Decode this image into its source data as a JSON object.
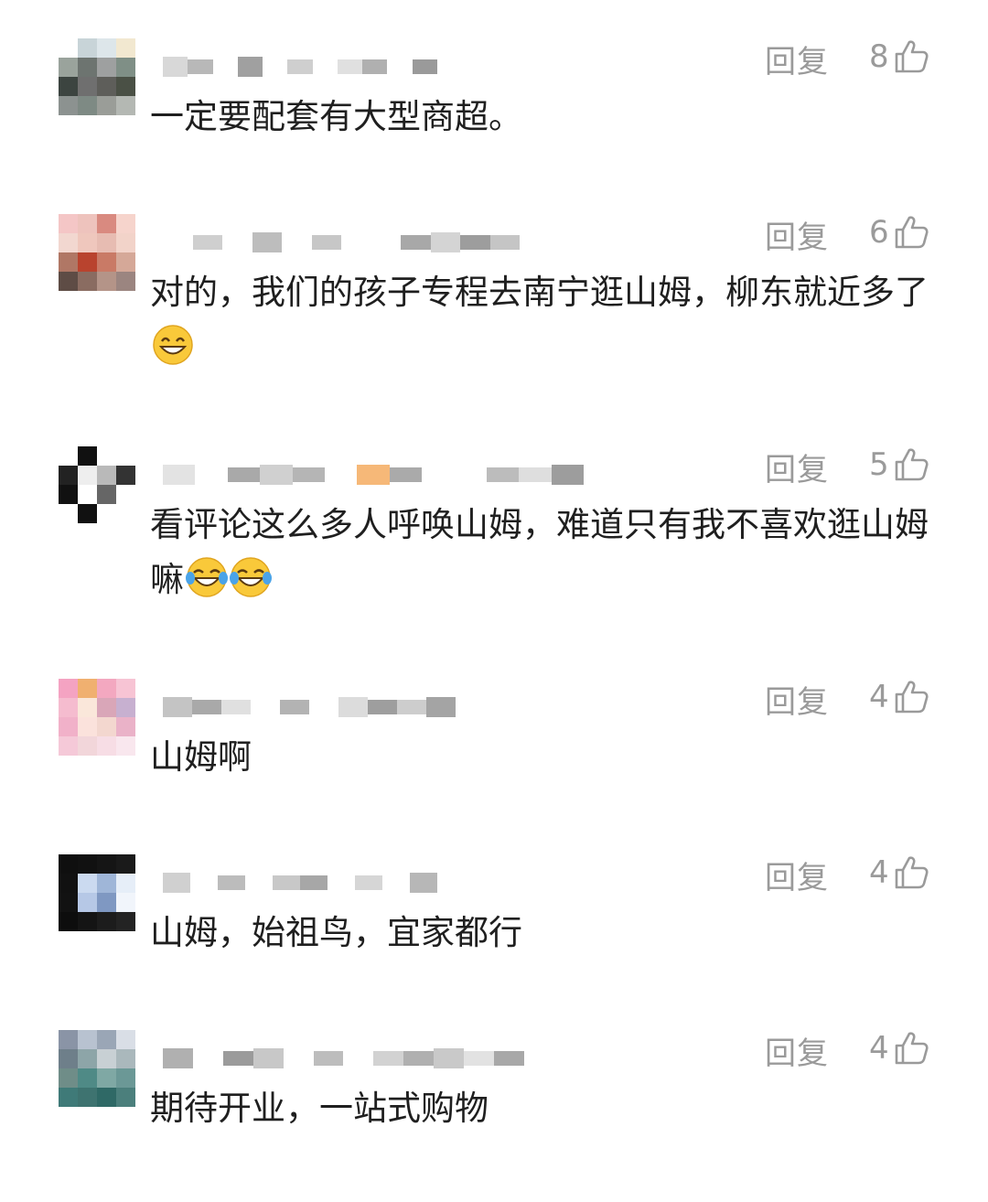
{
  "comments": [
    {
      "reply": "回复",
      "likes": "8",
      "text": "一定要配套有大型商超。",
      "emojis": [],
      "avatar": [
        "#ffffff",
        "#c8d4d8",
        "#dde6ea",
        "#f2e8d0",
        "#9aa39c",
        "#6d7470",
        "#9ea0a0",
        "#7f8f86",
        "#3c4440",
        "#6f6f6f",
        "#5e5e5a",
        "#4a5045",
        "#8c9290",
        "#7e8a84",
        "#9a9d98",
        "#b4b8b3"
      ],
      "username_blocks": [
        "#d8d8d8",
        "#b8b8b8",
        "#ffffff",
        "#a0a0a0",
        "#ffffff",
        "#cfcfcf",
        "#ffffff",
        "#e0e0e0",
        "#b0b0b0",
        "#ffffff",
        "#9a9a9a"
      ]
    },
    {
      "reply": "回复",
      "likes": "6",
      "text": "对的，我们的孩子专程去南宁逛山姆，柳东就近多了",
      "emojis": [
        "grinning-face"
      ],
      "avatar": [
        "#f4c6c6",
        "#eec3bd",
        "#d98a80",
        "#f6d4cc",
        "#f2d7d0",
        "#efc7bd",
        "#e7bcb2",
        "#f2d3c9",
        "#b07765",
        "#b9432e",
        "#c97a66",
        "#d5a898",
        "#5e4c45",
        "#8a6c61",
        "#b49488",
        "#9b8580"
      ],
      "username_blocks": [
        "#ffffff",
        "#cfcfcf",
        "#ffffff",
        "#bdbdbd",
        "#ffffff",
        "#c7c7c7",
        "#ffffff",
        "#ffffff",
        "#a8a8a8",
        "#d4d4d4",
        "#9d9d9d",
        "#c5c5c5"
      ]
    },
    {
      "reply": "回复",
      "likes": "5",
      "text": "看评论这么多人呼唤山姆，难道只有我不喜欢逛山姆嘛",
      "emojis": [
        "tears-of-joy-face",
        "tears-of-joy-face"
      ],
      "avatar": [
        "#ffffff",
        "#111111",
        "#ffffff",
        "#ffffff",
        "#222222",
        "#eeeeee",
        "#b9b9b9",
        "#333333",
        "#111111",
        "#ffffff",
        "#666666",
        "#ffffff",
        "#ffffff",
        "#111111",
        "#ffffff",
        "#ffffff"
      ],
      "username_blocks": [
        "#e3e3e3",
        "#ffffff",
        "#a9a9a9",
        "#d0d0d0",
        "#b5b5b5",
        "#ffffff",
        "#f6b878",
        "#aaaaaa",
        "#ffffff",
        "#ffffff",
        "#bcbcbc",
        "#dedede",
        "#9d9d9d"
      ]
    },
    {
      "reply": "回复",
      "likes": "4",
      "text": "山姆啊",
      "emojis": [],
      "avatar": [
        "#f4a3c2",
        "#f0b070",
        "#f3a8c0",
        "#f7c4d4",
        "#f5bccf",
        "#fae7da",
        "#d9a6b8",
        "#c7b0d0",
        "#f1b1c9",
        "#fbe2dc",
        "#f3d7cf",
        "#eab2c8",
        "#f5c9d8",
        "#f2d6da",
        "#f7dde5",
        "#f9e7ee"
      ],
      "username_blocks": [
        "#c4c4c4",
        "#a9a9a9",
        "#e0e0e0",
        "#ffffff",
        "#b3b3b3",
        "#ffffff",
        "#dcdcdc",
        "#9e9e9e",
        "#cdcdcd",
        "#a4a4a4"
      ]
    },
    {
      "reply": "回复",
      "likes": "4",
      "text": "山姆，始祖鸟，宜家都行",
      "emojis": [],
      "avatar": [
        "#0f0f0f",
        "#111111",
        "#151515",
        "#1a1a1a",
        "#111111",
        "#cbdaf0",
        "#9fb6d8",
        "#e6eef8",
        "#121212",
        "#b6c8e6",
        "#7f98c2",
        "#f1f5fb",
        "#0d0d0d",
        "#141414",
        "#1c1c1c",
        "#232323"
      ],
      "username_blocks": [
        "#d0d0d0",
        "#ffffff",
        "#bcbcbc",
        "#ffffff",
        "#c8c8c8",
        "#a7a7a7",
        "#ffffff",
        "#d6d6d6",
        "#ffffff",
        "#b7b7b7"
      ]
    },
    {
      "reply": "回复",
      "likes": "4",
      "text": "期待开业，一站式购物",
      "emojis": [],
      "avatar": [
        "#8a94a6",
        "#b8c2d0",
        "#9aa6b6",
        "#d9dee6",
        "#6e7f8a",
        "#8da5a8",
        "#c8d0d4",
        "#aab8bc",
        "#6f8d88",
        "#4f8a86",
        "#7fa8a4",
        "#6b9896",
        "#3f7a78",
        "#3e7370",
        "#2f6966",
        "#4b7f7c"
      ],
      "username_blocks": [
        "#b0b0b0",
        "#ffffff",
        "#9b9b9b",
        "#c8c8c8",
        "#ffffff",
        "#bdbdbd",
        "#ffffff",
        "#d2d2d2",
        "#b0b0b0",
        "#c9c9c9",
        "#e2e2e2",
        "#a8a8a8"
      ]
    }
  ]
}
